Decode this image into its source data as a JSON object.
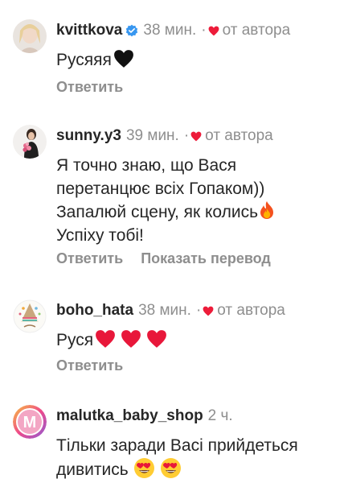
{
  "comments": [
    {
      "username": "kvittkova",
      "verified": true,
      "time": "38 мин.",
      "separator": "·",
      "liked_by_author": "от автора",
      "text": "Русяяя",
      "reply": "Ответить"
    },
    {
      "username": "sunny.y3",
      "time": "39 мин.",
      "separator": "·",
      "liked_by_author": "от автора",
      "lines": [
        "Я точно знаю, що Вася",
        "перетанцює всіх Гопаком))",
        "Запалюй сцену, як колись",
        "Успіху тобі!"
      ],
      "reply": "Ответить",
      "translate": "Показать перевод"
    },
    {
      "username": "boho_hata",
      "time": "38 мин.",
      "separator": "·",
      "liked_by_author": "от автора",
      "text": "Руся",
      "reply": "Ответить"
    },
    {
      "username": "malutka_baby_shop",
      "time": "2 ч.",
      "lines": [
        "Тільки заради Васі прийдеться",
        "дивитись"
      ]
    }
  ],
  "colors": {
    "text": "#262626",
    "muted": "#8e8e8e",
    "heart": "#ed1c3a",
    "verified": "#3897f0"
  },
  "icons": [
    "verified-badge-icon",
    "heart-icon",
    "black-heart-emoji",
    "red-heart-emoji",
    "fire-emoji",
    "heart-eyes-emoji"
  ]
}
